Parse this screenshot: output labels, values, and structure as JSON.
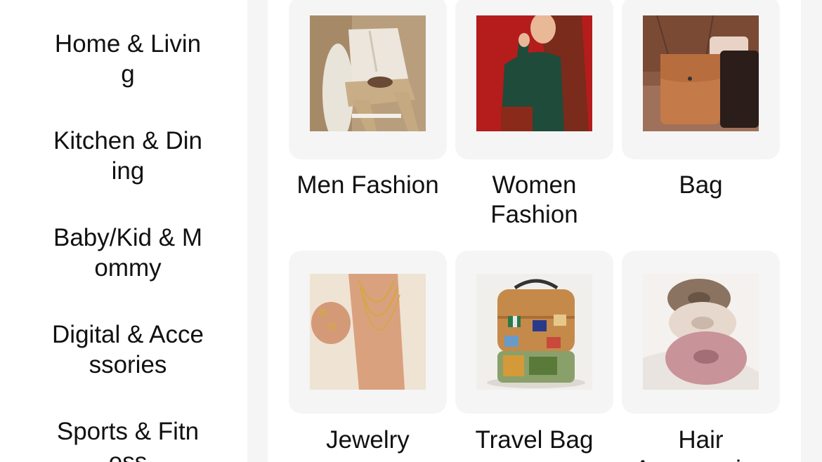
{
  "sidebar": {
    "items": [
      {
        "label": "Home & Living"
      },
      {
        "label": "Kitchen & Dining"
      },
      {
        "label": "Baby/Kid & Mommy"
      },
      {
        "label": "Digital & Accessories"
      },
      {
        "label": "Sports & Fitness"
      }
    ]
  },
  "categories": [
    {
      "label": "Men Fashion",
      "image": "men-fashion-photo"
    },
    {
      "label": "Women Fashion",
      "image": "women-fashion-photo"
    },
    {
      "label": "Bag",
      "image": "bag-photo"
    },
    {
      "label": "Jewelry",
      "image": "jewelry-photo"
    },
    {
      "label": "Travel Bag",
      "image": "travel-bag-photo"
    },
    {
      "label": "Hair Accessories",
      "image": "hair-accessories-photo"
    }
  ]
}
